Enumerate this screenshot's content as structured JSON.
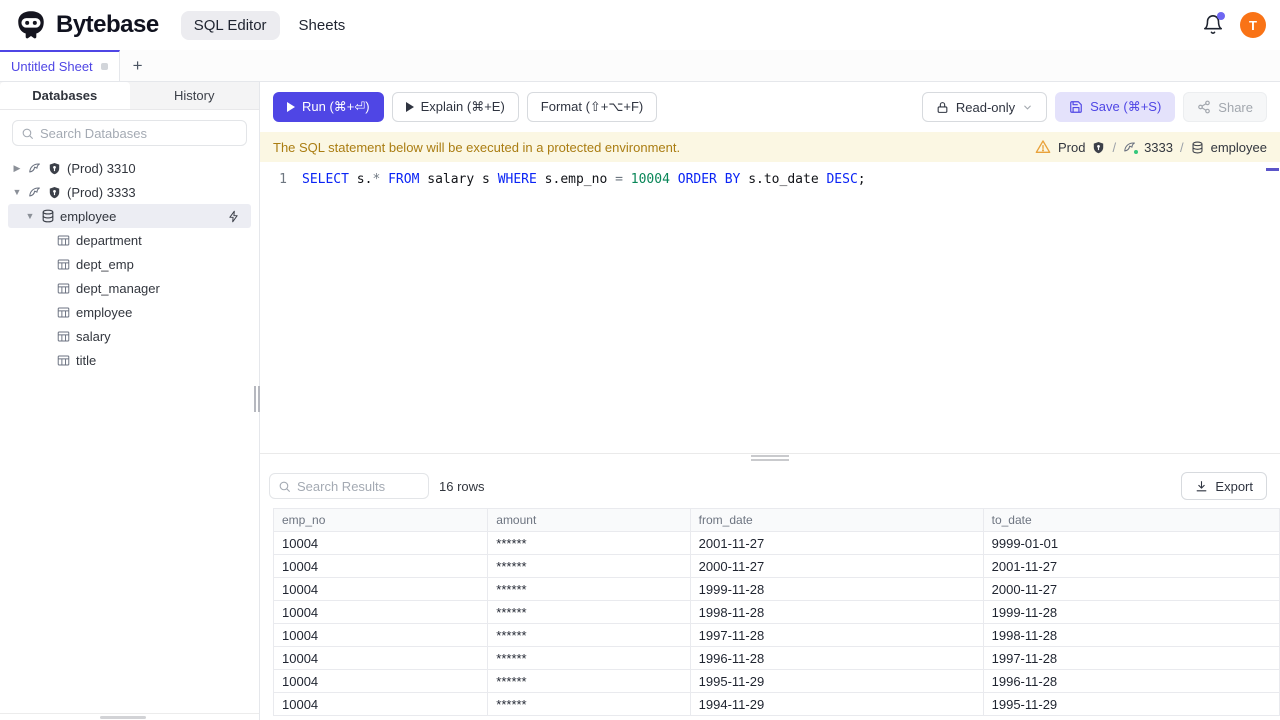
{
  "theme": {
    "accent": "#4f46e5",
    "save_button_bg": "#e4e2fb",
    "banner_bg": "#fbf7e3",
    "banner_text": "#aa7d12",
    "avatar_bg": "#f97316",
    "status_green": "#34c77b",
    "sql_keyword": "#0a24f5",
    "sql_number": "#098658"
  },
  "header": {
    "brand": "Bytebase",
    "nav": [
      {
        "label": "SQL Editor",
        "active": true
      },
      {
        "label": "Sheets",
        "active": false
      }
    ],
    "avatar_text": "T"
  },
  "tabstrip": {
    "sheet_title": "Untitled Sheet",
    "new_tab_label": "+"
  },
  "sidebar": {
    "tabs": {
      "databases": "Databases",
      "history": "History"
    },
    "search_placeholder": "Search Databases",
    "tree": {
      "instances": [
        {
          "label": "(Prod) 3310",
          "expanded": false
        },
        {
          "label": "(Prod) 3333",
          "expanded": true
        }
      ],
      "database": {
        "label": "employee",
        "selected": true
      },
      "tables": [
        "department",
        "dept_emp",
        "dept_manager",
        "employee",
        "salary",
        "title"
      ]
    }
  },
  "toolbar": {
    "run_label": "Run (⌘+⏎)",
    "explain_label": "Explain (⌘+E)",
    "format_label": "Format (⇧+⌥+F)",
    "readonly_label": "Read-only",
    "save_label": "Save (⌘+S)",
    "share_label": "Share"
  },
  "banner": {
    "message": "The SQL statement below will be executed in a protected environment.",
    "environment": "Prod",
    "separator": "/",
    "instance": "3333",
    "database": "employee"
  },
  "editor": {
    "line_number": "1",
    "sql_text": "SELECT s.* FROM salary s WHERE s.emp_no = 10004 ORDER BY s.to_date DESC;",
    "tokens": [
      {
        "text": "SELECT",
        "type": "keyword"
      },
      {
        "text": " s.",
        "type": "ident"
      },
      {
        "text": "*",
        "type": "operator"
      },
      {
        "text": " ",
        "type": "ident"
      },
      {
        "text": "FROM",
        "type": "keyword"
      },
      {
        "text": " salary s ",
        "type": "ident"
      },
      {
        "text": "WHERE",
        "type": "keyword"
      },
      {
        "text": " s.emp_no ",
        "type": "ident"
      },
      {
        "text": "=",
        "type": "operator"
      },
      {
        "text": " ",
        "type": "ident"
      },
      {
        "text": "10004",
        "type": "number"
      },
      {
        "text": " ",
        "type": "ident"
      },
      {
        "text": "ORDER BY",
        "type": "keyword"
      },
      {
        "text": " s.to_date ",
        "type": "ident"
      },
      {
        "text": "DESC",
        "type": "keyword"
      },
      {
        "text": ";",
        "type": "ident"
      }
    ]
  },
  "results": {
    "search_placeholder": "Search Results",
    "row_count": "16 rows",
    "export_label": "Export",
    "columns": [
      "emp_no",
      "amount",
      "from_date",
      "to_date"
    ],
    "rows": [
      [
        "10004",
        "******",
        "2001-11-27",
        "9999-01-01"
      ],
      [
        "10004",
        "******",
        "2000-11-27",
        "2001-11-27"
      ],
      [
        "10004",
        "******",
        "1999-11-28",
        "2000-11-27"
      ],
      [
        "10004",
        "******",
        "1998-11-28",
        "1999-11-28"
      ],
      [
        "10004",
        "******",
        "1997-11-28",
        "1998-11-28"
      ],
      [
        "10004",
        "******",
        "1996-11-28",
        "1997-11-28"
      ],
      [
        "10004",
        "******",
        "1995-11-29",
        "1996-11-28"
      ],
      [
        "10004",
        "******",
        "1994-11-29",
        "1995-11-29"
      ]
    ]
  }
}
